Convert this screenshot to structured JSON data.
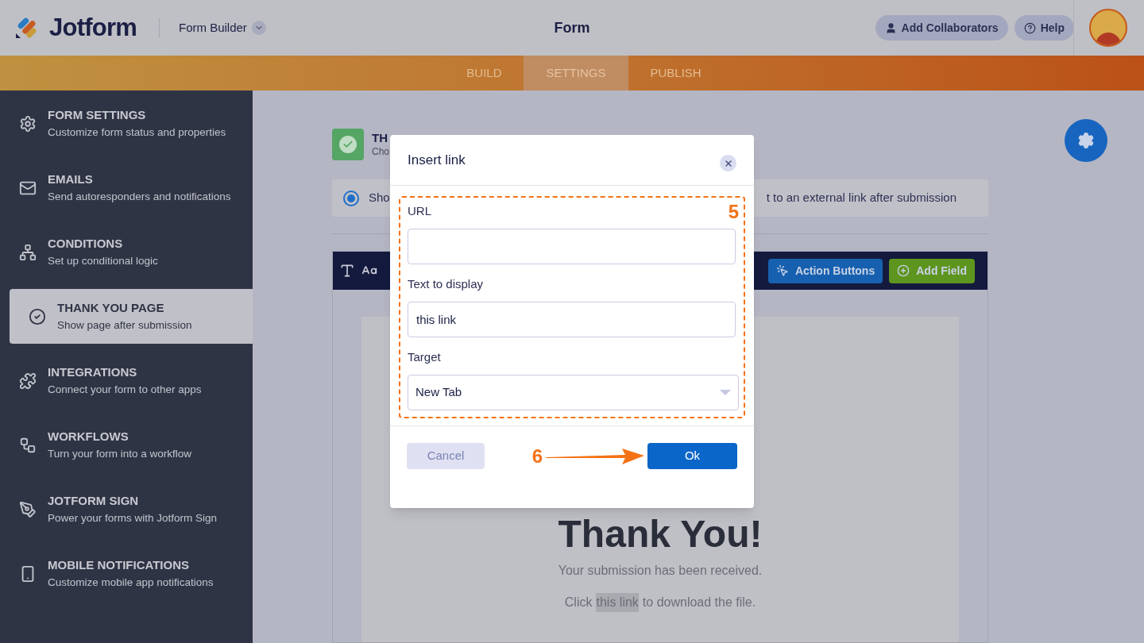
{
  "header": {
    "brand": "Jotform",
    "product": "Form Builder",
    "title": "Form",
    "buttons": [
      {
        "label": "Add Collaborators",
        "kind": "user"
      },
      {
        "label": "Help",
        "kind": "help"
      }
    ]
  },
  "tabs": [
    {
      "label": "BUILD",
      "selected": false
    },
    {
      "label": "SETTINGS",
      "selected": true
    },
    {
      "label": "PUBLISH",
      "selected": false
    }
  ],
  "sidebar": {
    "items": [
      {
        "title": "FORM SETTINGS",
        "subtitle": "Customize form status and properties",
        "selected": false
      },
      {
        "title": "EMAILS",
        "subtitle": "Send autoresponders and notifications",
        "selected": false
      },
      {
        "title": "CONDITIONS",
        "subtitle": "Set up conditional logic",
        "selected": false
      },
      {
        "title": "THANK YOU PAGE",
        "subtitle": "Show page after submission",
        "selected": true
      },
      {
        "title": "INTEGRATIONS",
        "subtitle": "Connect your form to other apps",
        "selected": false
      },
      {
        "title": "WORKFLOWS",
        "subtitle": "Turn your form into a workflow",
        "selected": false
      },
      {
        "title": "JOTFORM SIGN",
        "subtitle": "Power your forms with Jotform Sign",
        "selected": false
      },
      {
        "title": "MOBILE NOTIFICATIONS",
        "subtitle": "Customize mobile app notifications",
        "selected": false
      }
    ]
  },
  "page_header": {
    "title": "TH",
    "subtitle": "Cho"
  },
  "redirect_option": {
    "label_start": "Sho",
    "label_end": "t to an external link after submission",
    "selected": true
  },
  "toolbar": {
    "buttons": [
      {
        "label": "Action Buttons",
        "kind": "action"
      },
      {
        "label": "Add Field",
        "kind": "add"
      }
    ]
  },
  "preview": {
    "heading": "Thank You!",
    "message": "Your submission has been received.",
    "link_line": {
      "before": "Click",
      "link": "this link",
      "after": "to download the file."
    }
  },
  "dialog": {
    "title": "Insert link",
    "fields": [
      {
        "label": "URL",
        "kind": "text"
      },
      {
        "label": "Text to display",
        "kind": "text",
        "value": "this link"
      },
      {
        "label": "Target",
        "kind": "select",
        "value": "New Tab"
      }
    ],
    "cancel": {
      "label": "Cancel",
      "disabled": true
    },
    "ok": {
      "label": "Ok"
    }
  },
  "annotations": [
    {
      "label": "5"
    },
    {
      "label": "6"
    }
  ]
}
